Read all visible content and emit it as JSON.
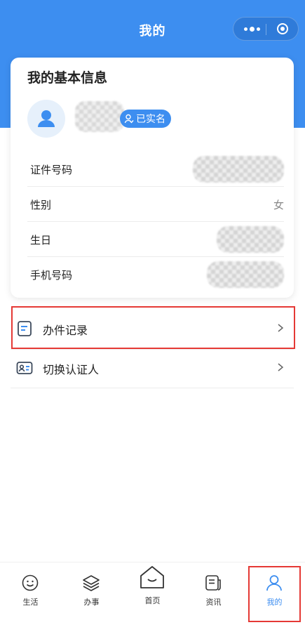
{
  "nav": {
    "title": "我的"
  },
  "card": {
    "title": "我的基本信息",
    "verified_badge": "已实名",
    "rows": [
      {
        "label": "证件号码",
        "value": ""
      },
      {
        "label": "性别",
        "value": "女"
      },
      {
        "label": "生日",
        "value": ""
      },
      {
        "label": "手机号码",
        "value": ""
      }
    ]
  },
  "menu": [
    {
      "label": "办件记录",
      "icon": "document-list-icon"
    },
    {
      "label": "切换认证人",
      "icon": "id-card-icon"
    }
  ],
  "tabbar": [
    {
      "label": "生活",
      "icon": "smile-icon"
    },
    {
      "label": "办事",
      "icon": "layers-icon"
    },
    {
      "label": "首页",
      "icon": "home-icon"
    },
    {
      "label": "资讯",
      "icon": "news-icon"
    },
    {
      "label": "我的",
      "icon": "person-icon",
      "active": true
    }
  ],
  "colors": {
    "primary": "#3d8ef0",
    "highlight": "#e53935"
  }
}
